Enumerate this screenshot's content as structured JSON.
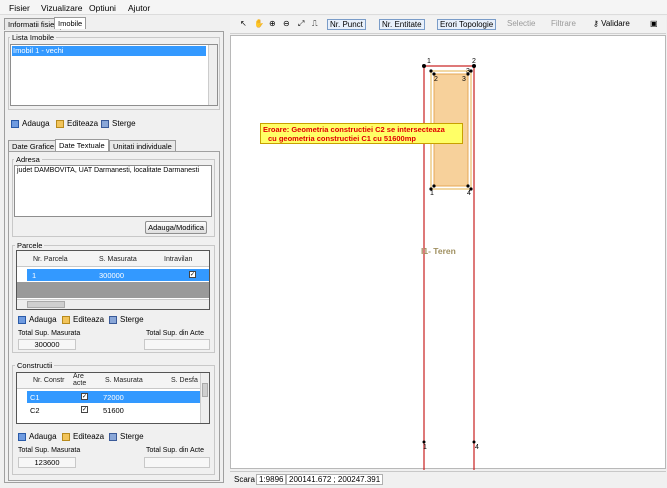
{
  "menu": [
    "Fisier",
    "Vizualizare",
    "Optiuni",
    "Ajutor"
  ],
  "left_tabs": [
    "Informatii fisier",
    "Imobile"
  ],
  "lista_imobile": {
    "title": "Lista Imobile",
    "items": [
      "Imobil 1 - vechi"
    ]
  },
  "actions": {
    "add": "Adauga",
    "edit": "Editeaza",
    "delete": "Sterge"
  },
  "detail_tabs": [
    "Date Grafice",
    "Date Textuale",
    "Unitati individuale"
  ],
  "adresa": {
    "title": "Adresa",
    "text": "judet DAMBOVITA, UAT Darmanesti, localitate Darmanesti",
    "button": "Adauga/Modifica"
  },
  "parcele": {
    "title": "Parcele",
    "columns": [
      "Nr. Parcela",
      "S. Masurata",
      "Intravilan"
    ],
    "rows": [
      {
        "nr": "1",
        "suprafata": "300000",
        "intravilan": "✓"
      }
    ],
    "total_masurata_label": "Total Sup. Masurata",
    "total_masurata": "300000",
    "total_acte_label": "Total Sup. din Acte"
  },
  "constructii": {
    "title": "Constructii",
    "columns": [
      "Nr. Constr",
      "Are acte",
      "S. Masurata",
      "S. Desfa"
    ],
    "rows": [
      {
        "nr": "C1",
        "acte": "✓",
        "suprafata": "72000"
      },
      {
        "nr": "C2",
        "acte": "✓",
        "suprafata": "51600"
      }
    ],
    "total_masurata_label": "Total Sup. Masurata",
    "total_masurata": "123600",
    "total_acte_label": "Total Sup. din Acte"
  },
  "toolbar": {
    "nr_punct": "Nr. Punct",
    "nr_entitate": "Nr. Entitate",
    "erori": "Erori Topologie",
    "selectie": "Selectie",
    "filtrare": "Filtrare",
    "validare": "Validare"
  },
  "map": {
    "error_line1": "Eroare: Geometria constructiei C2 se intersecteaza",
    "error_line2": "cu geometria constructiei C1 cu 51600mp",
    "teren_label": "I1- Teren",
    "points": {
      "p1": "1",
      "p2": "2",
      "p3": "3",
      "p4": "4",
      "c1": "1",
      "c2": "2",
      "c3": "3",
      "c4": "4",
      "s1": "1",
      "s4": "4"
    }
  },
  "status": {
    "scara_label": "Scara",
    "scara": "1:9896",
    "coords": "200141.672 ; 200247.391"
  },
  "colors": {
    "selection": "#3399ff",
    "error_bg": "#ffff66",
    "error_text": "#e00000",
    "building_fill": "#f6c98a",
    "parcel_line": "#c81e1e"
  }
}
